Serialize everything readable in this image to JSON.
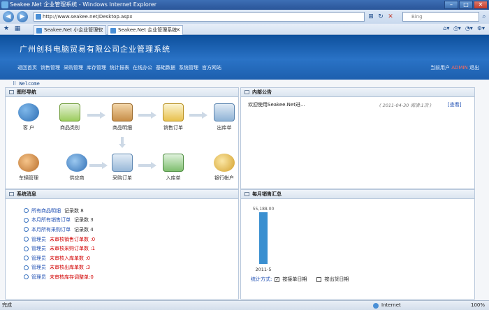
{
  "window": {
    "title": "Seakee.Net 企业管理系统 - Windows Internet Explorer"
  },
  "browser": {
    "url": "http://www.seakee.net/Desktop.aspx",
    "search_placeholder": "Bing",
    "tabs": [
      {
        "label": "Seakee.Net 小企业管理软件"
      },
      {
        "label": "Seakee.Net 企业管理系统"
      }
    ]
  },
  "app": {
    "title": "广州创科电脑贸易有限公司企业管理系统",
    "nav": [
      "返回首页",
      "销售管理",
      "采购管理",
      "库存管理",
      "统计报表",
      "在线办公",
      "基础数据",
      "系统管理",
      "官方网站"
    ],
    "user_prefix": "当前用户",
    "user_name": "ADMIN",
    "logout": "退出"
  },
  "welcome": "Welcome",
  "panels": {
    "nav_title": "图形导航",
    "notice_title": "内部公告",
    "messages_title": "系统消息",
    "chart_title": "每月销售汇总"
  },
  "nav_nodes": {
    "customer": "客 户",
    "category": "商品类别",
    "product": "商品明细",
    "sales_order": "销售订单",
    "outbound": "出库单",
    "vehicle": "车辆管理",
    "supplier": "供应商",
    "purchase_order": "采购订单",
    "inbound": "入库单",
    "bank": "银行帐户"
  },
  "notice": {
    "title": "欢迎使用Seakee.Net进...",
    "date": "( 2011-04-30  阅读:1次 )",
    "view": "[查看]"
  },
  "messages": [
    {
      "link": "所有商品明细",
      "text": "记录数 8",
      "alert": false
    },
    {
      "link": "本月所有销售订单",
      "text": "记录数 3",
      "alert": false
    },
    {
      "link": "本月所有采购订单",
      "text": "记录数 4",
      "alert": false
    },
    {
      "link": "管理员",
      "text": "未审核销售订单数 :0",
      "alert": true
    },
    {
      "link": "管理员",
      "text": "未审核采购订单数 :1",
      "alert": true
    },
    {
      "link": "管理员",
      "text": "未审核入库单数 :0",
      "alert": true
    },
    {
      "link": "管理员",
      "text": "未审核出库单数 :3",
      "alert": true
    },
    {
      "link": "管理员",
      "text": "未审核库存调整单:0",
      "alert": true
    }
  ],
  "chart_data": {
    "type": "bar",
    "categories": [
      "2011-5"
    ],
    "values": [
      55188.0
    ],
    "data_labels": [
      "55,188.00"
    ],
    "ylim": [
      0,
      55188.0
    ],
    "bar_color": "#3a8fd0"
  },
  "chart_options": {
    "label": "统计方式:",
    "by_order_date": "按接单日期",
    "by_order_date_checked": true,
    "by_ship_date": "按出货日期",
    "by_ship_date_checked": false
  },
  "status": {
    "left": "完成",
    "zone": "Internet",
    "zoom": "100%"
  }
}
